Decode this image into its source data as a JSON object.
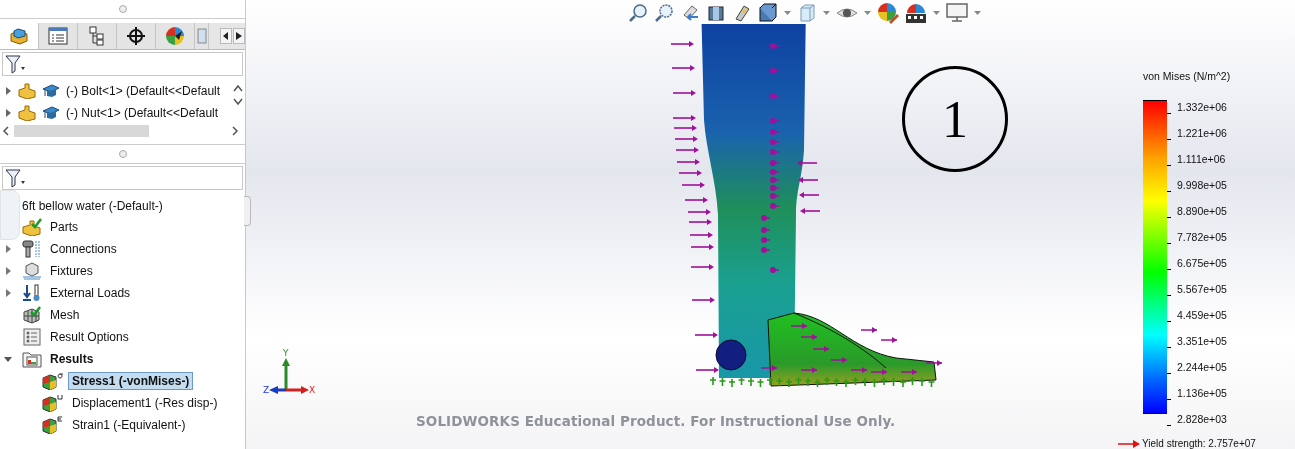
{
  "panel_tabs": [
    {
      "kind": "model",
      "selected": true
    },
    {
      "kind": "properties",
      "selected": false
    },
    {
      "kind": "config",
      "selected": false
    },
    {
      "kind": "target",
      "selected": false
    },
    {
      "kind": "appearance",
      "selected": false
    },
    {
      "kind": "more",
      "selected": false
    }
  ],
  "model_tree": {
    "items": [
      {
        "label": "(-) Bolt<1> (Default<<Default",
        "expanded": false
      },
      {
        "label": "(-) Nut<1> (Default<<Default",
        "expanded": false
      }
    ]
  },
  "study_tree": {
    "root": "6ft bellow water (-Default-)",
    "items": [
      {
        "label": "Parts",
        "kind": "parts"
      },
      {
        "label": "Connections",
        "kind": "connections",
        "expanded": false
      },
      {
        "label": "Fixtures",
        "kind": "fixtures",
        "expanded": false
      },
      {
        "label": "External Loads",
        "kind": "loads",
        "expanded": false
      },
      {
        "label": "Mesh",
        "kind": "mesh"
      },
      {
        "label": "Result Options",
        "kind": "options"
      },
      {
        "label": "Results",
        "kind": "results",
        "expanded": true,
        "children": [
          {
            "label": "Stress1 (-vonMises-)",
            "kind": "stress",
            "selected": true
          },
          {
            "label": "Displacement1 (-Res disp-)",
            "kind": "displacement",
            "selected": false
          },
          {
            "label": "Strain1 (-Equivalent-)",
            "kind": "strain",
            "selected": false
          }
        ]
      }
    ]
  },
  "viewport": {
    "callout": "1",
    "triad": {
      "x": "X",
      "y": "Y",
      "z": "Z"
    },
    "notice": "SOLIDWORKS Educational Product. For Instructional Use Only."
  },
  "legend": {
    "title": "von Mises (N/m^2)",
    "ticks": [
      "1.332e+06",
      "1.221e+06",
      "1.111e+06",
      "9.998e+05",
      "8.890e+05",
      "7.782e+05",
      "6.675e+05",
      "5.567e+05",
      "4.459e+05",
      "3.351e+05",
      "2.244e+05",
      "1.136e+05",
      "2.828e+03"
    ],
    "yield": "Yield strength: 2.757e+07"
  }
}
